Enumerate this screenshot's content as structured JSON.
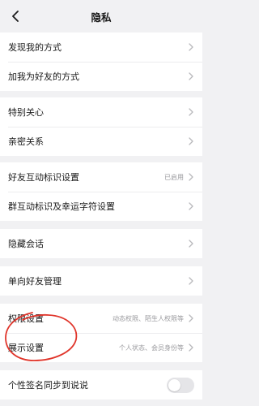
{
  "header": {
    "title": "隐私",
    "back_icon": "chevron-left-icon"
  },
  "groups": [
    {
      "items": [
        {
          "label": "发现我的方式"
        },
        {
          "label": "加我为好友的方式"
        }
      ]
    },
    {
      "items": [
        {
          "label": "特别关心"
        },
        {
          "label": "亲密关系"
        }
      ]
    },
    {
      "items": [
        {
          "label": "好友互动标识设置",
          "value": "已启用"
        },
        {
          "label": "群互动标识及幸运字符设置"
        }
      ]
    },
    {
      "items": [
        {
          "label": "隐藏会话"
        }
      ]
    },
    {
      "items": [
        {
          "label": "单向好友管理"
        }
      ]
    },
    {
      "items": [
        {
          "label": "权限设置",
          "value": "动态权限、陌生人权限等"
        },
        {
          "label": "展示设置",
          "value": "个人状态、会员身份等"
        }
      ]
    },
    {
      "items": [
        {
          "label": "个性签名同步到说说",
          "toggle": false
        }
      ]
    }
  ],
  "colors": {
    "background": "#f1f1f3",
    "annotation": "#e0352b",
    "toggle_off": "#e5e5e8"
  }
}
